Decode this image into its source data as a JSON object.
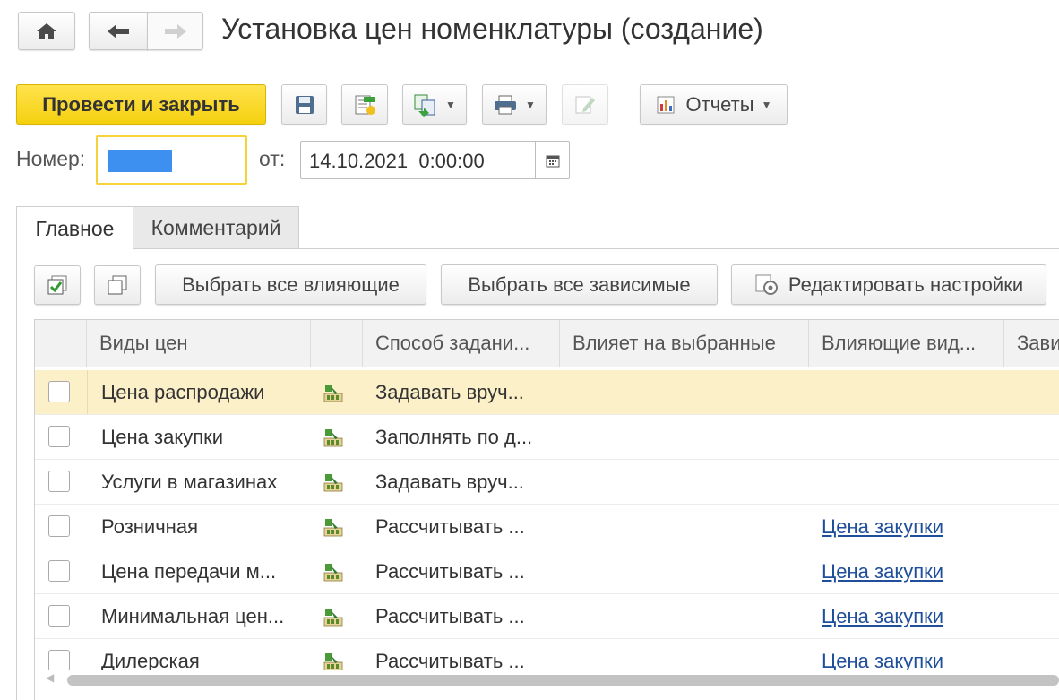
{
  "window": {
    "title": "Установка цен номенклатуры (создание)"
  },
  "nav": {
    "home_icon": "home-icon",
    "back_icon": "arrow-left-icon",
    "forward_icon": "arrow-right-icon"
  },
  "toolbar": {
    "post_close_label": "Провести и закрыть",
    "reports_label": "Отчеты",
    "icons": [
      "save-icon",
      "post-icon",
      "create-based-icon",
      "print-icon",
      "edit-icon",
      "report-icon"
    ]
  },
  "header_fields": {
    "number_label": "Номер:",
    "number_value": "",
    "from_label": "от:",
    "date_value": "14.10.2021  0:00:00"
  },
  "tabs": [
    {
      "label": "Главное",
      "active": true
    },
    {
      "label": "Комментарий",
      "active": false
    }
  ],
  "grid_toolbar": {
    "select_influencing": "Выбрать все влияющие",
    "select_dependent": "Выбрать все зависимые",
    "edit_settings": "Редактировать настройки"
  },
  "grid": {
    "columns": [
      "Виды цен",
      "Способ задани...",
      "Влияет на выбранные",
      "Влияющие вид...",
      "Зави"
    ],
    "rows": [
      {
        "name": "Цена распродажи",
        "method": "Задавать вруч...",
        "influencing": "",
        "selected": true
      },
      {
        "name": "Цена закупки",
        "method": "Заполнять по д...",
        "influencing": "",
        "selected": false
      },
      {
        "name": "Услуги в магазинах",
        "method": "Задавать вруч...",
        "influencing": "",
        "selected": false
      },
      {
        "name": "Розничная",
        "method": "Рассчитывать ...",
        "influencing": "Цена закупки",
        "selected": false
      },
      {
        "name": "Цена передачи м...",
        "method": "Рассчитывать ...",
        "influencing": "Цена закупки",
        "selected": false
      },
      {
        "name": "Минимальная цен...",
        "method": "Рассчитывать ...",
        "influencing": "Цена закупки",
        "selected": false
      },
      {
        "name": "Дилерская",
        "method": "Рассчитывать ...",
        "influencing": "Цена закупки",
        "selected": false
      }
    ]
  },
  "colors": {
    "primary_button": "#f5d010",
    "selected_row": "#fbf0c8",
    "number_highlight": "#3d8ff0",
    "link": "#1f4e9a"
  }
}
